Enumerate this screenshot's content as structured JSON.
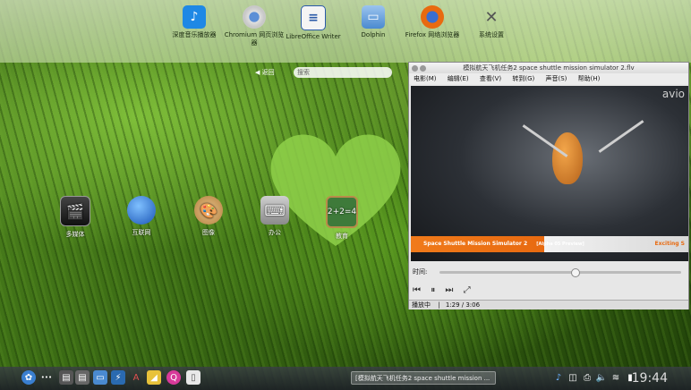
{
  "top_dock": [
    {
      "label": "深度音乐播放器",
      "icon": "music-player-icon",
      "color": "#1e88e5"
    },
    {
      "label": "Chromium 网页浏览器",
      "icon": "chromium-icon",
      "color": "#5c8fd6"
    },
    {
      "label": "LibreOffice Writer",
      "icon": "libreoffice-writer-icon",
      "color": "#2a5aa8"
    },
    {
      "label": "Dolphin",
      "icon": "dolphin-icon",
      "color": "#4a8ad0"
    },
    {
      "label": "Firefox 网络浏览器",
      "icon": "firefox-icon",
      "color": "#e86a10"
    },
    {
      "label": "系统设置",
      "icon": "settings-icon",
      "color": "#777777"
    }
  ],
  "launcher": {
    "back_label": "返回",
    "search_placeholder": "搜索"
  },
  "desktop_items": [
    {
      "label": "多媒体",
      "icon": "multimedia-icon"
    },
    {
      "label": "互联网",
      "icon": "internet-icon"
    },
    {
      "label": "图像",
      "icon": "graphics-icon"
    },
    {
      "label": "办公",
      "icon": "office-icon"
    },
    {
      "label": "教育",
      "icon": "education-icon"
    }
  ],
  "player": {
    "title": "模拟航天飞机任务2 space shuttle mission simulator 2.flv",
    "menu": [
      "电影(M)",
      "编辑(E)",
      "查看(V)",
      "转到(G)",
      "声音(S)",
      "帮助(H)"
    ],
    "banner_text": "Space Shuttle Mission Simulator 2",
    "banner_tag": "[Alpha 05 Preview]",
    "banner_right": "Exciting S",
    "corner_text": "avio",
    "time_label": "时间:",
    "progress_fraction": 0.56,
    "status_state": "播放中",
    "status_time": "1:29 / 3:06"
  },
  "taskbar": {
    "task_title": "[模拟航天飞机任务2 space shuttle mission ...",
    "clock": "19:44"
  }
}
